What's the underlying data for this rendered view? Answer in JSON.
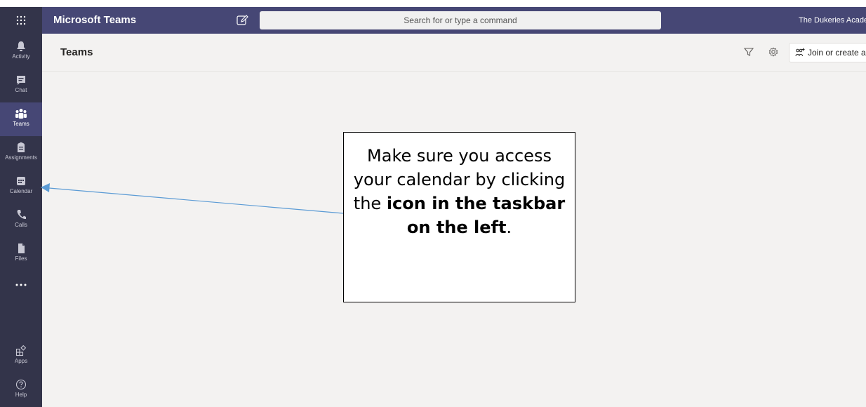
{
  "topbar": {
    "app_title": "Microsoft Teams",
    "search_placeholder": "Search for or type a command",
    "org_name": "The Dukeries Academy"
  },
  "rail": {
    "items": [
      {
        "label": "Activity",
        "icon": "bell-icon"
      },
      {
        "label": "Chat",
        "icon": "chat-icon"
      },
      {
        "label": "Teams",
        "icon": "teams-icon",
        "active": true
      },
      {
        "label": "Assignments",
        "icon": "assignments-icon"
      },
      {
        "label": "Calendar",
        "icon": "calendar-icon"
      },
      {
        "label": "Calls",
        "icon": "phone-icon"
      },
      {
        "label": "Files",
        "icon": "file-icon"
      },
      {
        "label": "",
        "icon": "more-icon"
      },
      {
        "label": "Apps",
        "icon": "apps-icon"
      },
      {
        "label": "Help",
        "icon": "help-icon"
      }
    ]
  },
  "main": {
    "title": "Teams",
    "join_label": "Join or create a team"
  },
  "callout": {
    "line1": "Make sure you access your calendar by clicking the ",
    "bold1": "icon in the taskbar on the left",
    "end": "."
  },
  "colors": {
    "rail": "#33344a",
    "topbar": "#464775",
    "arrow": "#5b9bd5"
  }
}
